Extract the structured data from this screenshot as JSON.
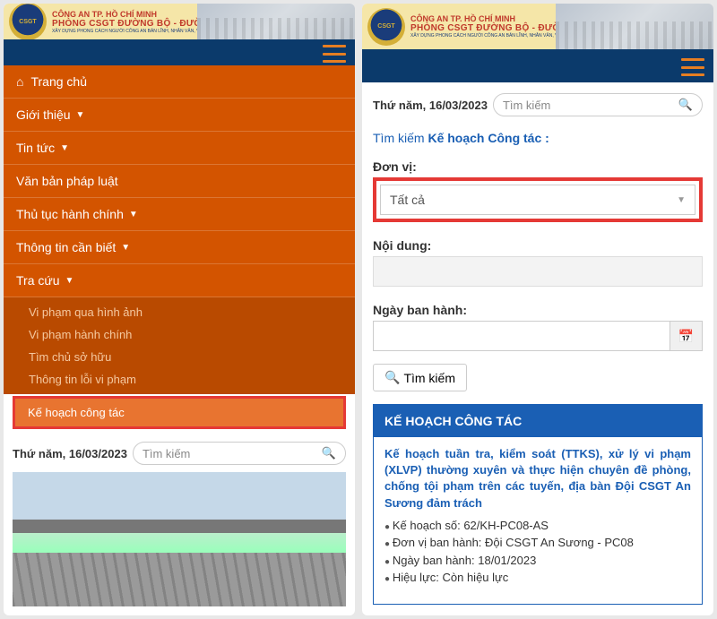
{
  "banner": {
    "logo_acronym": "CSGT",
    "line1": "CÔNG AN TP. HỒ CHÍ MINH",
    "line2": "PHÒNG CSGT ĐƯỜNG BỘ - ĐƯỜNG SẮT",
    "line3": "XÂY DỰNG PHONG CÁCH NGƯỜI CÔNG AN BẢN LĨNH, NHÂN VĂN, VÌ NHÂN DÂN PHỤC VỤ"
  },
  "menu": {
    "home": "Trang chủ",
    "intro": "Giới thiệu",
    "news": "Tin tức",
    "legal": "Văn bản pháp luật",
    "admin": "Thủ tục hành chính",
    "info": "Thông tin cần biết",
    "lookup": "Tra cứu",
    "sub": {
      "s1": "Vi phạm qua hình ảnh",
      "s2": "Vi phạm hành chính",
      "s3": "Tìm chủ sở hữu",
      "s4": "Thông tin lỗi vi phạm",
      "s5": "Kế hoạch công tác"
    }
  },
  "date_label": "Thứ năm, 16/03/2023",
  "search_placeholder": "Tìm kiếm",
  "right": {
    "search_title_prefix": "Tìm kiếm ",
    "search_title_bold": "Kế hoạch Công tác :",
    "unit_label": "Đơn vị:",
    "unit_value": "Tất cả",
    "content_label": "Nội dung:",
    "issue_date_label": "Ngày ban hành:",
    "search_btn": "Tìm kiếm",
    "panel_title": "KẾ HOẠCH CÔNG TÁC",
    "plan": {
      "title": "Kế hoạch tuần tra, kiểm soát (TTKS), xử lý vi phạm (XLVP) thường xuyên và thực hiện chuyên đề phòng, chống tội phạm trên các tuyến, địa bàn Đội CSGT An Sương đảm trách",
      "m1": "Kế hoạch số: 62/KH-PC08-AS",
      "m2": "Đơn vị ban hành: Đội CSGT An Sương - PC08",
      "m3": "Ngày ban hành: 18/01/2023",
      "m4": "Hiệu lực: Còn hiệu lực"
    }
  }
}
